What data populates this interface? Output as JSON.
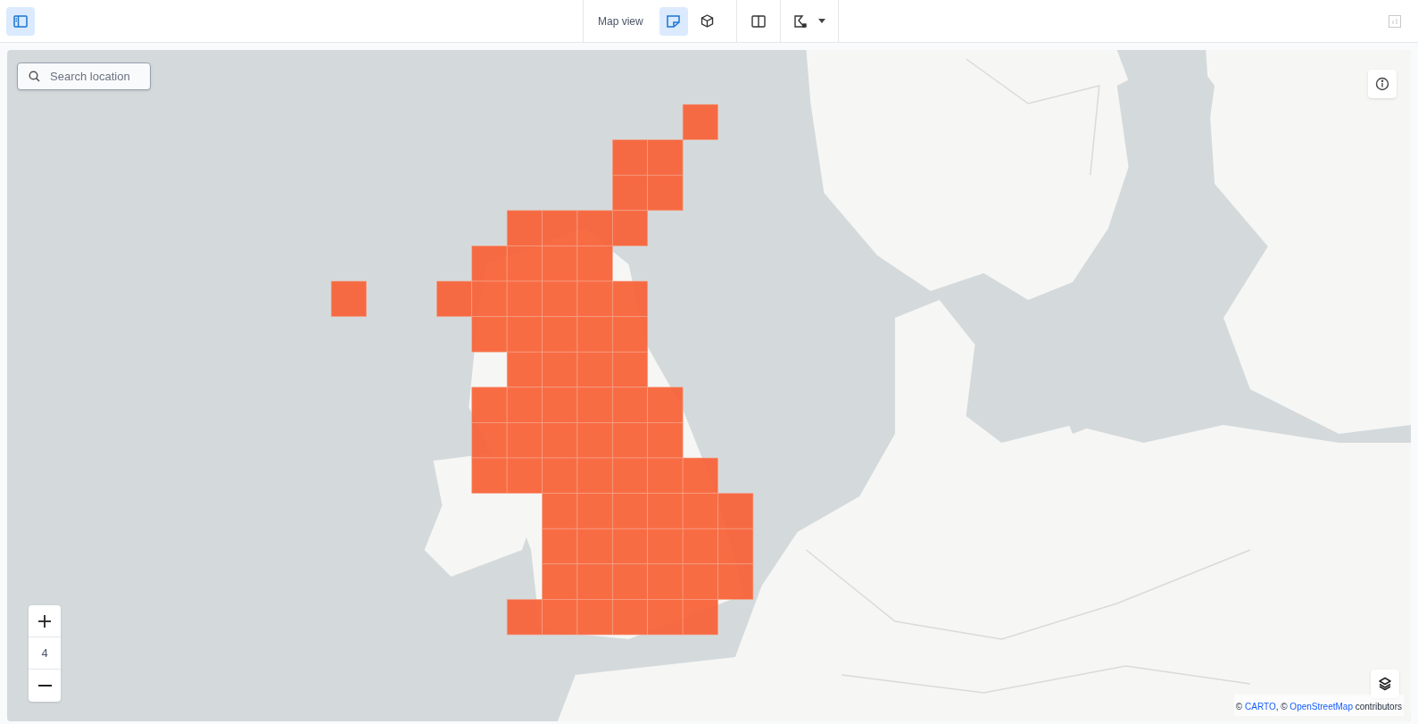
{
  "toolbar": {
    "sidebar_toggle": {
      "selected": true
    },
    "view_label": "Map view",
    "view_modes": [
      {
        "kind": "flat",
        "selected": true
      },
      {
        "kind": "cube",
        "selected": false
      }
    ],
    "split_view": {
      "selected": false
    },
    "draw_tool": {
      "selected": false
    },
    "chart_panel": {
      "disabled": true
    }
  },
  "search": {
    "placeholder": "Search location"
  },
  "zoom": {
    "level_text": "4"
  },
  "attribution": [
    {
      "kind": "plain",
      "text": "© "
    },
    {
      "kind": "link",
      "text": "CARTO"
    },
    {
      "kind": "plain",
      "text": ", © "
    },
    {
      "kind": "link",
      "text": "OpenStreetMap"
    },
    {
      "kind": "plain",
      "text": " contributors"
    }
  ]
}
